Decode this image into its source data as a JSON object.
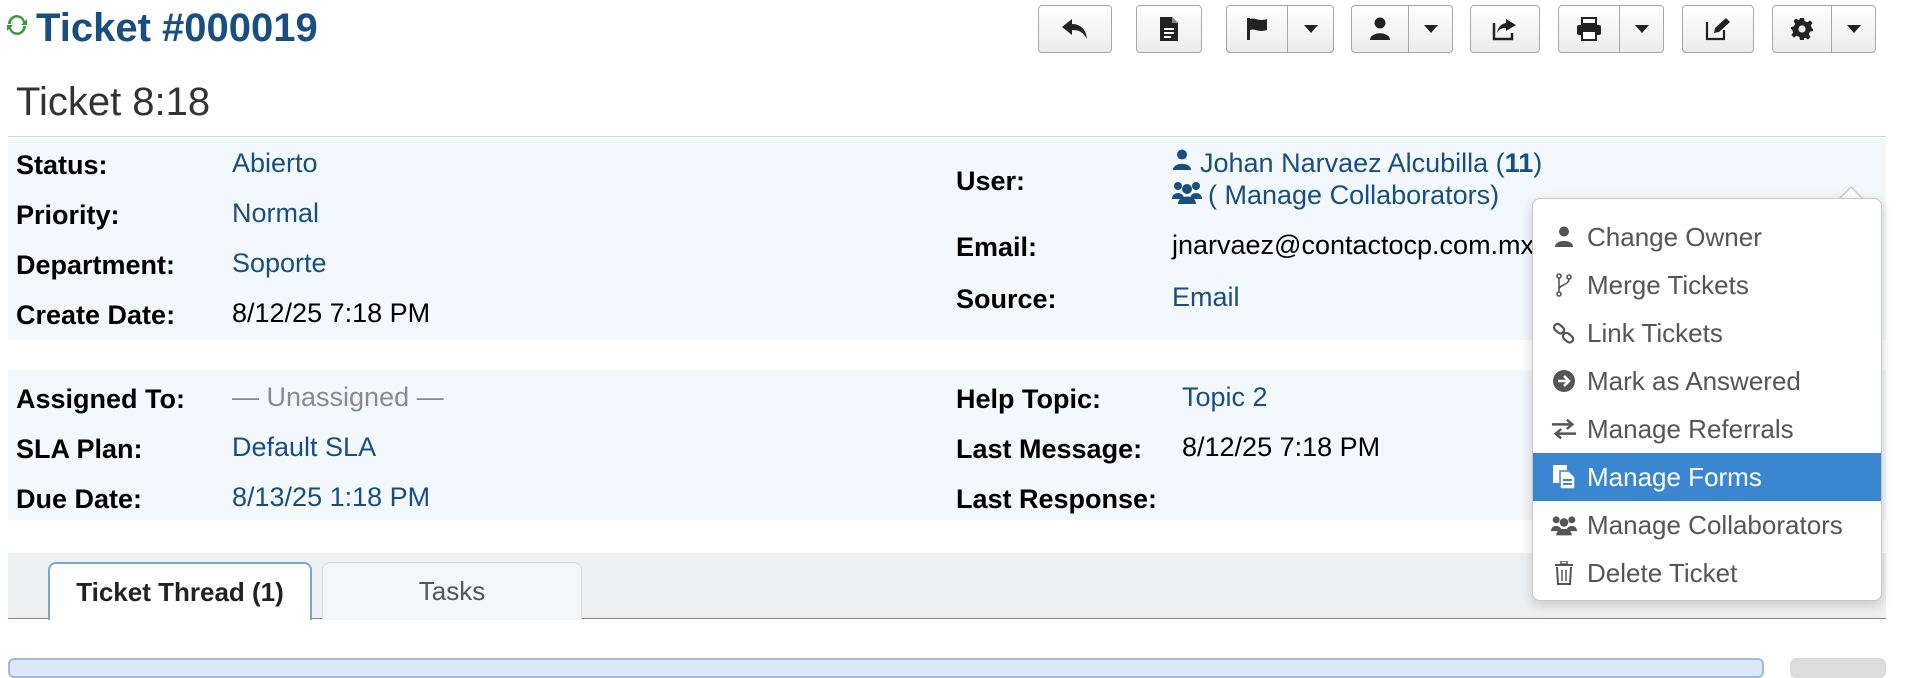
{
  "header": {
    "ticket_number": "Ticket #000019",
    "subject": "Ticket 8:18"
  },
  "toolbar": {
    "buttons": [
      "reply-icon",
      "note-icon",
      "flag-icon",
      "user-icon",
      "share-icon",
      "print-icon",
      "edit-icon",
      "gear-icon"
    ]
  },
  "info": {
    "status_label": "Status:",
    "status_value": "Abierto",
    "priority_label": "Priority:",
    "priority_value": "Normal",
    "department_label": "Department:",
    "department_value": "Soporte",
    "create_date_label": "Create Date:",
    "create_date_value": "8/12/25 7:18 PM",
    "user_label": "User:",
    "user_name": "Johan Narvaez Alcubilla (",
    "user_count": "11",
    "user_close": ")",
    "collaborators_link": "( Manage Collaborators)",
    "email_label": "Email:",
    "email_value": "jnarvaez@contactocp.com.mx",
    "source_label": "Source:",
    "source_value": "Email"
  },
  "assign": {
    "assigned_label": "Assigned To:",
    "assigned_value": "— Unassigned —",
    "sla_label": "SLA Plan:",
    "sla_value": "Default SLA",
    "due_label": "Due Date:",
    "due_value": "8/13/25 1:18 PM",
    "help_topic_label": "Help Topic:",
    "help_topic_value": "Topic 2",
    "last_message_label": "Last Message:",
    "last_message_value": "8/12/25 7:18 PM",
    "last_response_label": "Last Response:"
  },
  "tabs": {
    "thread": "Ticket Thread (1)",
    "tasks": "Tasks"
  },
  "menu": {
    "items": [
      {
        "label": "Change Owner",
        "icon": "user-icon"
      },
      {
        "label": "Merge Tickets",
        "icon": "merge-icon"
      },
      {
        "label": "Link Tickets",
        "icon": "link-icon"
      },
      {
        "label": "Mark as Answered",
        "icon": "answered-icon"
      },
      {
        "label": "Manage Referrals",
        "icon": "exchange-icon"
      },
      {
        "label": "Manage Forms",
        "icon": "forms-icon"
      },
      {
        "label": "Manage Collaborators",
        "icon": "group-icon"
      },
      {
        "label": "Delete Ticket",
        "icon": "trash-icon"
      }
    ],
    "active_index": 5
  },
  "colors": {
    "link": "#184E81",
    "active_menu": "#3a86d1",
    "panel_bg": "#f3f8fc"
  }
}
